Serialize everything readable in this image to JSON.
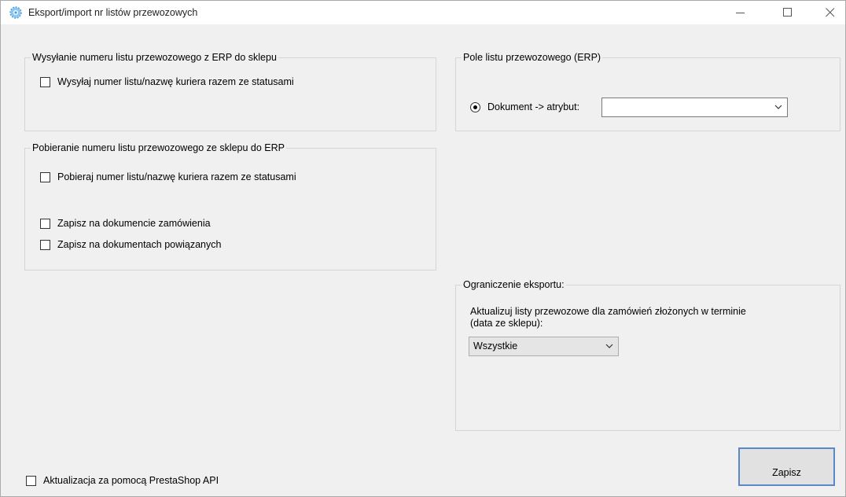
{
  "window": {
    "title": "Eksport/import nr listów przewozowych",
    "icon": "gear-icon"
  },
  "send_group": {
    "legend": "Wysyłanie numeru listu przewozowego z ERP do sklepu",
    "send_with_status_label": "Wysyłaj numer listu/nazwę kuriera razem ze statusami",
    "send_with_status_checked": false
  },
  "fetch_group": {
    "legend": "Pobieranie numeru listu przewozowego ze sklepu do ERP",
    "fetch_with_status_label": "Pobieraj numer listu/nazwę kuriera razem ze statusami",
    "fetch_with_status_checked": false,
    "save_order_label": "Zapisz na dokumencie zamówienia",
    "save_order_checked": false,
    "save_related_label": "Zapisz na dokumentach powiązanych",
    "save_related_checked": false
  },
  "field_group": {
    "legend": "Pole listu przewozowego (ERP)",
    "radio_label": "Dokument -> atrybut:",
    "radio_selected": true,
    "attribute_value": ""
  },
  "limit_group": {
    "legend": "Ograniczenie eksportu:",
    "description_line1": "Aktualizuj listy przewozowe dla zamówień złożonych w terminie",
    "description_line2": "(data ze sklepu):",
    "range_value": "Wszystkie"
  },
  "api_checkbox": {
    "label": "Aktualizacja za pomocą PrestaShop API",
    "checked": false
  },
  "save_button": {
    "label": "Zapisz"
  },
  "colors": {
    "window_bg": "#f0f0f0",
    "button_border": "#5a89c8",
    "group_border": "#d5d5d5"
  }
}
